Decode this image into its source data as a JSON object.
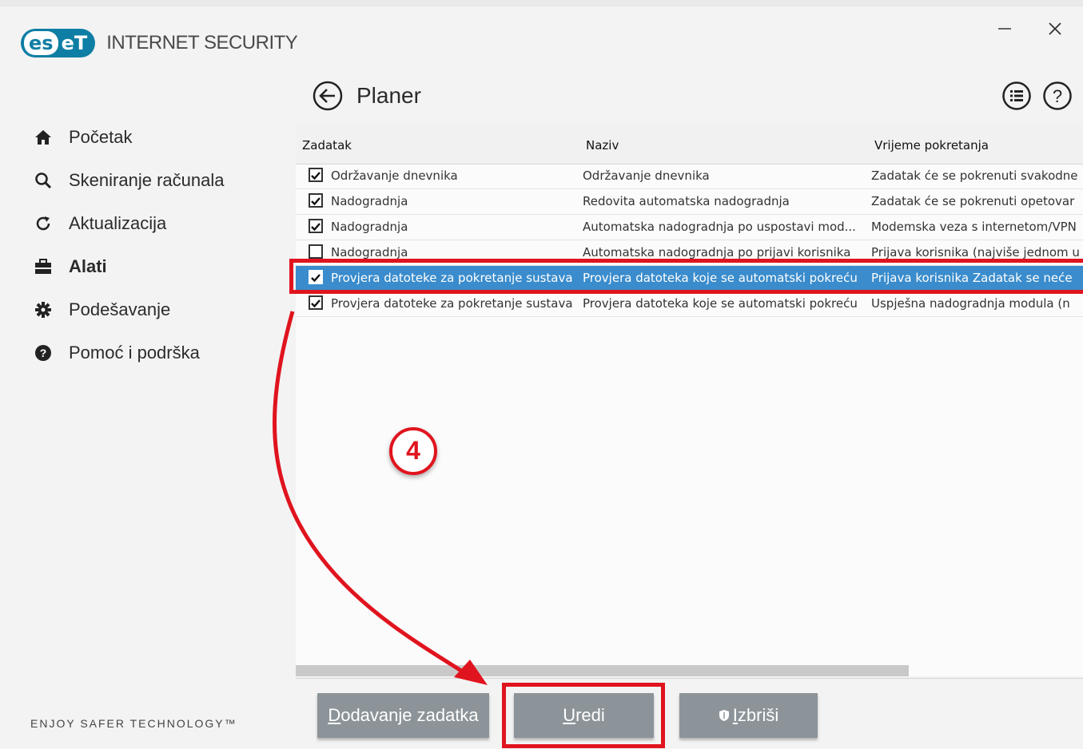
{
  "app": {
    "logo_letters_a": "es",
    "logo_letters_b": "eT",
    "product_name": "INTERNET SECURITY",
    "tagline": "ENJOY SAFER TECHNOLOGY™",
    "brand_color": "#0e7ea4",
    "window_buttons": {
      "minimize_icon": "minimize-icon",
      "close_icon": "close-icon"
    }
  },
  "sidebar": {
    "items": [
      {
        "label": "Početak",
        "icon": "home-icon",
        "active": false
      },
      {
        "label": "Skeniranje računala",
        "icon": "search-icon",
        "active": false
      },
      {
        "label": "Aktualizacija",
        "icon": "refresh-icon",
        "active": false
      },
      {
        "label": "Alati",
        "icon": "briefcase-icon",
        "active": true
      },
      {
        "label": "Podešavanje",
        "icon": "gear-icon",
        "active": false
      },
      {
        "label": "Pomoć i podrška",
        "icon": "help-icon",
        "active": false
      }
    ]
  },
  "page": {
    "title": "Planer",
    "back_icon": "back-arrow-icon",
    "header_icons": [
      "list-icon",
      "help-icon"
    ]
  },
  "table": {
    "columns": [
      "Zadatak",
      "Naziv",
      "Vrijeme pokretanja"
    ],
    "rows": [
      {
        "checked": true,
        "selected": false,
        "task": "Održavanje dnevnika",
        "name": "Održavanje dnevnika",
        "time": "Zadatak će se pokrenuti svakodne"
      },
      {
        "checked": true,
        "selected": false,
        "task": "Nadogradnja",
        "name": "Redovita automatska nadogradnja",
        "time": "Zadatak će se pokrenuti opetovar"
      },
      {
        "checked": true,
        "selected": false,
        "task": "Nadogradnja",
        "name": "Automatska nadogradnja po uspostavi mod...",
        "time": "Modemska veza s internetom/VPN"
      },
      {
        "checked": false,
        "selected": false,
        "task": "Nadogradnja",
        "name": "Automatska nadogradnja po prijavi korisnika",
        "time": "Prijava korisnika (najviše jednom u"
      },
      {
        "checked": true,
        "selected": true,
        "task": "Provjera datoteke za pokretanje sustava",
        "name": "Provjera datoteka koje se automatski pokreću",
        "time": "Prijava korisnika Zadatak se neće"
      },
      {
        "checked": true,
        "selected": false,
        "task": "Provjera datoteke za pokretanje sustava",
        "name": "Provjera datoteka koje se automatski pokreću",
        "time": "Uspješna nadogradnja modula (n"
      }
    ]
  },
  "buttons": {
    "add": {
      "mnemonic": "D",
      "rest": "odavanje zadatka"
    },
    "edit": {
      "mnemonic": "U",
      "rest": "redi"
    },
    "delete": {
      "mnemonic": "I",
      "rest": "zbriši",
      "icon": "shield-icon"
    }
  },
  "annotation": {
    "step_number": "4",
    "color": "#e0141e"
  }
}
